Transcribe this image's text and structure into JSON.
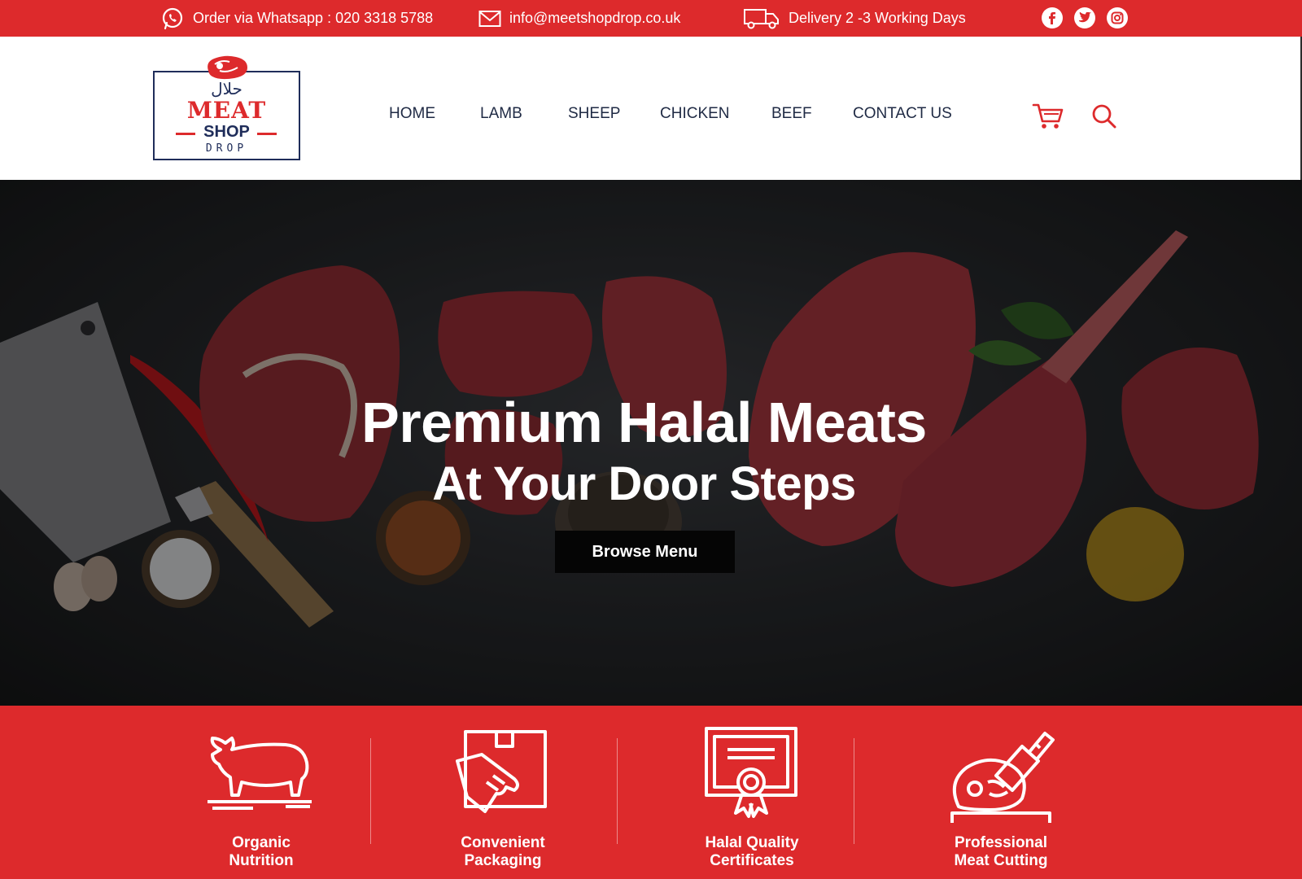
{
  "topbar": {
    "whatsapp": "Order via Whatsapp : 020 3318 5788",
    "email": "info@meetshopdrop.co.uk",
    "delivery": "Delivery 2 -3 Working Days",
    "icons": [
      "whatsapp-icon",
      "mail-icon",
      "truck-icon"
    ],
    "social": [
      "facebook-icon",
      "twitter-icon",
      "instagram-icon"
    ]
  },
  "logo": {
    "arabic": "حلال",
    "line1": "MEAT",
    "line2": "SHOP",
    "line3": "DROP"
  },
  "nav": {
    "items": [
      "HOME",
      "LAMB",
      "SHEEP",
      "CHICKEN",
      "BEEF",
      "CONTACT US"
    ]
  },
  "header_icons": [
    "cart-icon",
    "search-icon"
  ],
  "hero": {
    "title_line1": "Premium Halal Meats",
    "title_line2": "At Your Door Steps",
    "button": "Browse Menu"
  },
  "features": [
    {
      "line1": "Organic",
      "line2": "Nutrition",
      "icon": "cow-icon"
    },
    {
      "line1": "Convenient",
      "line2": "Packaging",
      "icon": "package-hand-icon"
    },
    {
      "line1": "Halal Quality",
      "line2": "Certificates",
      "icon": "certificate-icon"
    },
    {
      "line1": "Professional",
      "line2": "Meat Cutting",
      "icon": "meat-cleaver-icon"
    }
  ],
  "colors": {
    "brand_red": "#dd2a2c",
    "navy": "#1f2d5a",
    "button_black": "#050505"
  }
}
